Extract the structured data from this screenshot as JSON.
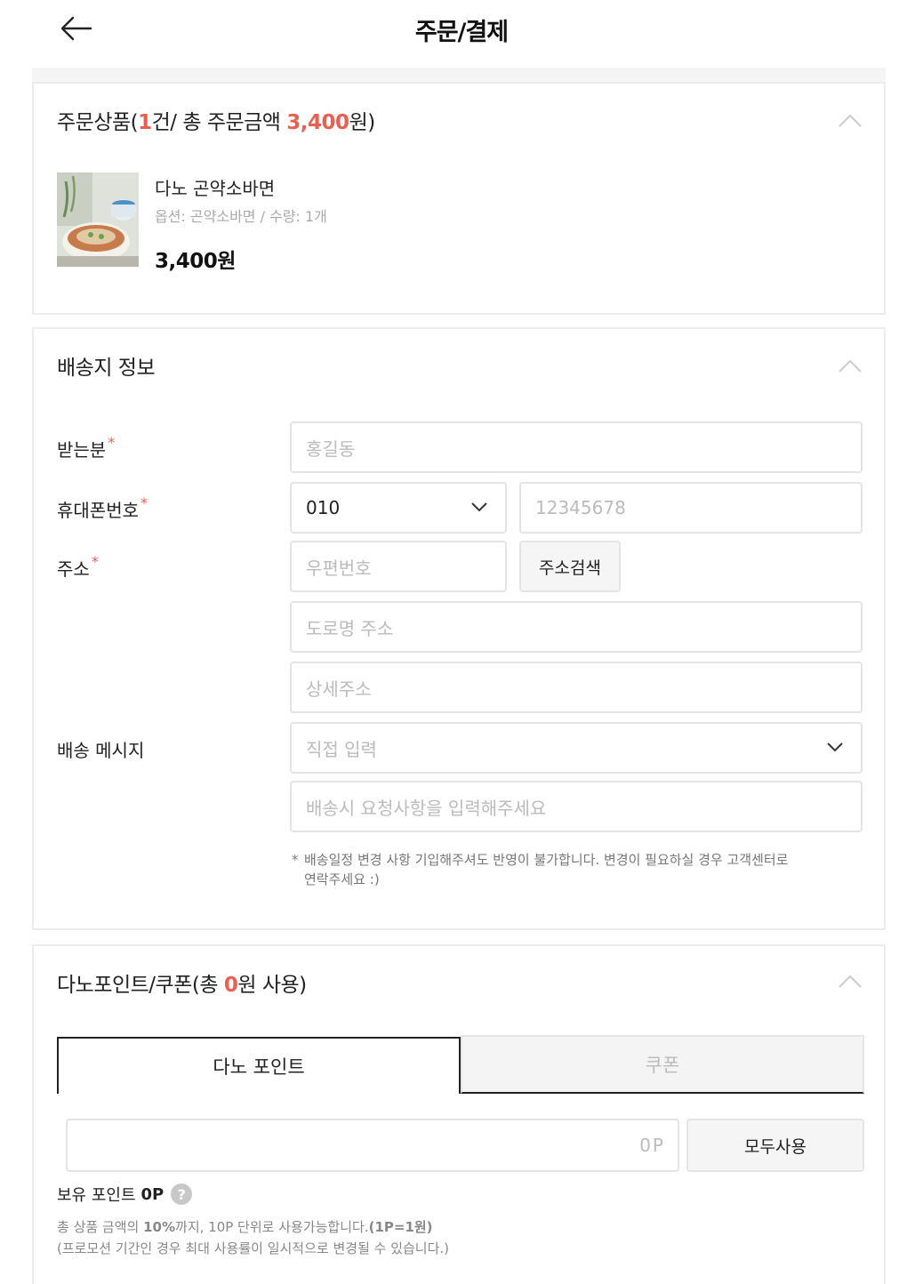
{
  "header": {
    "title": "주문/결제"
  },
  "order_products": {
    "title_prefix": "주문상품(",
    "count": "1",
    "title_mid": "건/ 총 주문금액 ",
    "total": "3,400",
    "title_suffix": "원)",
    "item": {
      "name": "다노 곤약소바면",
      "option": "옵션: 곤약소바면 / 수량: 1개",
      "price": "3,400원"
    }
  },
  "shipping": {
    "title": "배송지 정보",
    "receiver_label": "받는분",
    "receiver_placeholder": "홍길동",
    "phone_label": "휴대폰번호",
    "phone_prefix": "010",
    "phone_placeholder": "12345678",
    "address_label": "주소",
    "zipcode_placeholder": "우편번호",
    "address_search_label": "주소검색",
    "road_address_placeholder": "도로명 주소",
    "detail_address_placeholder": "상세주소",
    "message_label": "배송 메시지",
    "message_select": "직접 입력",
    "message_placeholder": "배송시 요청사항을 입력해주세요",
    "required_mark": "*",
    "note_star": "*",
    "note_line1": "배송일정 변경 사항 기입해주셔도 반영이 불가합니다. 변경이 필요하실 경우 고객센터로",
    "note_line2": "연락주세요 :)"
  },
  "points": {
    "title_prefix": "다노포인트/쿠폰(총 ",
    "used_amount": "0",
    "title_suffix": "원 사용)",
    "tabs": [
      {
        "label": "다노 포인트",
        "active": true
      },
      {
        "label": "쿠폰",
        "active": false
      }
    ],
    "input_value": "0P",
    "use_all_label": "모두사용",
    "owned_label": "보유 포인트",
    "owned_value": "0P",
    "help_symbol": "?",
    "desc_line1_a": "총 상품 금액의 ",
    "desc_line1_b": "10%",
    "desc_line1_c": "까지, 10P 단위로 사용가능합니다.",
    "desc_line1_d": "(1P=1원)",
    "desc_line2": "(프로모션 기간인 경우 최대 사용률이 일시적으로 변경될 수 있습니다.)"
  },
  "colors": {
    "accent": "#e8604f",
    "border": "#e4e4e4"
  },
  "icons": {
    "back": "arrow-left-icon",
    "collapse": "chevron-up-icon",
    "dropdown": "chevron-down-icon",
    "help": "question-icon"
  }
}
